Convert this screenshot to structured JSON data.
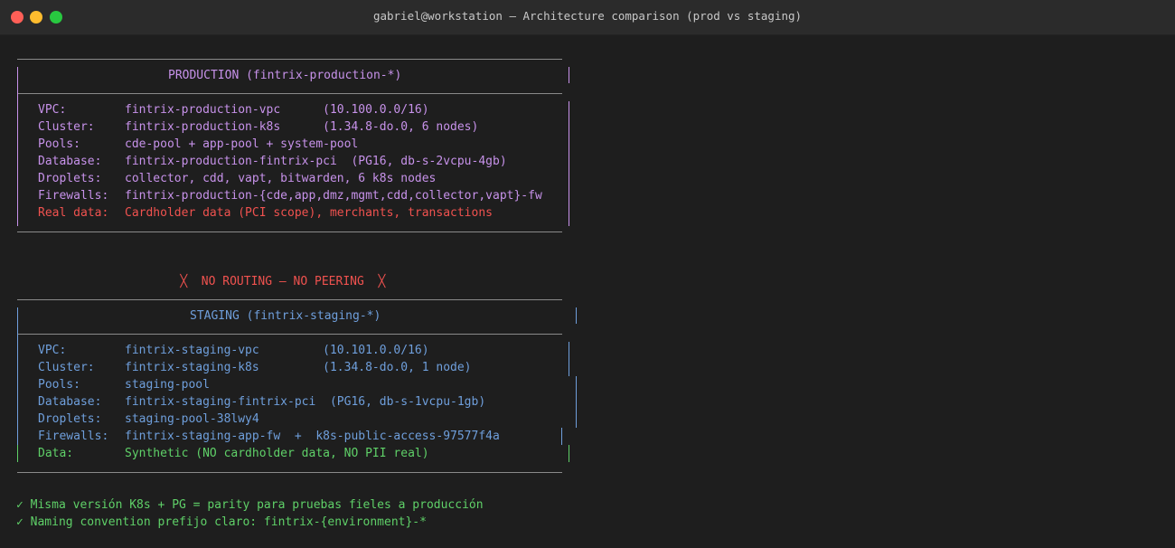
{
  "window": {
    "title": "gabriel@workstation — Architecture comparison (prod vs staging)"
  },
  "colors": {
    "production": "#c792ea",
    "staging": "#6f9fdc",
    "alert": "#f0524f",
    "ok": "#5fd068",
    "background": "#1e1e1e"
  },
  "production": {
    "header": "PRODUCTION (fintrix-production-*)",
    "rows": [
      {
        "key": "VPC:",
        "value": "fintrix-production-vpc      (10.100.0.0/16)"
      },
      {
        "key": "Cluster:",
        "value": "fintrix-production-k8s      (1.34.8-do.0, 6 nodes)"
      },
      {
        "key": "Pools:",
        "value": "cde-pool + app-pool + system-pool"
      },
      {
        "key": "Database:",
        "value": "fintrix-production-fintrix-pci  (PG16, db-s-2vcpu-4gb)"
      },
      {
        "key": "Droplets:",
        "value": "collector, cdd, vapt, bitwarden, 6 k8s nodes"
      },
      {
        "key": "Firewalls:",
        "value": "fintrix-production-{cde,app,dmz,mgmt,cdd,collector,vapt}-fw"
      },
      {
        "key": "Real data:",
        "value": "Cardholder data (PCI scope), merchants, transactions"
      }
    ]
  },
  "separator": {
    "icon_left": "╳",
    "text": "NO ROUTING — NO PEERING",
    "icon_right": "╳"
  },
  "staging": {
    "header": "STAGING (fintrix-staging-*)",
    "rows": [
      {
        "key": "VPC:",
        "value": "fintrix-staging-vpc         (10.101.0.0/16)"
      },
      {
        "key": "Cluster:",
        "value": "fintrix-staging-k8s         (1.34.8-do.0, 1 node)"
      },
      {
        "key": "Pools:",
        "value": "staging-pool"
      },
      {
        "key": "Database:",
        "value": "fintrix-staging-fintrix-pci  (PG16, db-s-1vcpu-1gb)"
      },
      {
        "key": "Droplets:",
        "value": "staging-pool-38lwy4"
      },
      {
        "key": "Firewalls:",
        "value": "fintrix-staging-app-fw  +  k8s-public-access-97577f4a"
      },
      {
        "key": "Data:",
        "value": "Synthetic (NO cardholder data, NO PII real)"
      }
    ]
  },
  "notes": [
    {
      "check": "✓",
      "text": "Misma versión K8s + PG = parity para pruebas fieles a producción"
    },
    {
      "check": "✓",
      "text": "Naming convention prefijo claro: fintrix-{environment}-*"
    }
  ]
}
